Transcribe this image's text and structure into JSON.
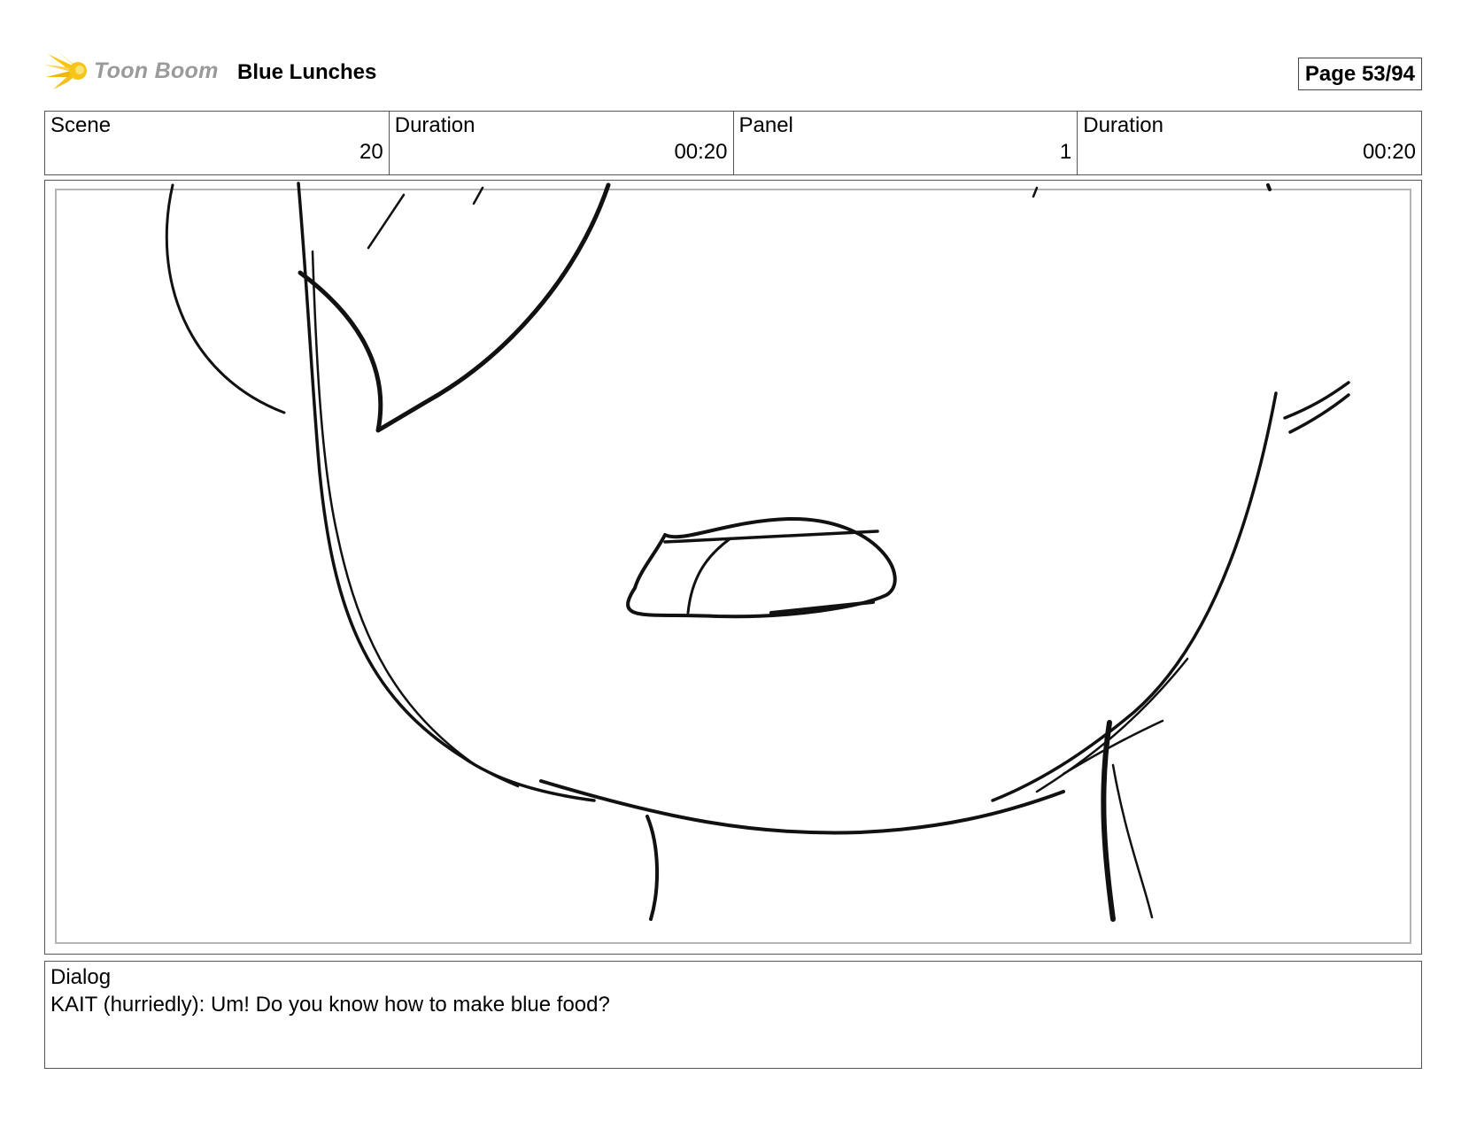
{
  "header": {
    "logo_text": "Toon Boom",
    "title": "Blue Lunches",
    "page": "Page 53/94"
  },
  "info": [
    {
      "label": "Scene",
      "value": "20"
    },
    {
      "label": "Duration",
      "value": "00:20"
    },
    {
      "label": "Panel",
      "value": "1"
    },
    {
      "label": "Duration",
      "value": "00:20"
    }
  ],
  "dialog": {
    "label": "Dialog",
    "text": "KAIT (hurriedly): Um! Do you know how to make blue food?"
  },
  "colors": {
    "logo_star": "#f5c518",
    "logo_text": "#9a9a9a",
    "border": "#555555",
    "safe_frame": "#b5b5b5"
  }
}
